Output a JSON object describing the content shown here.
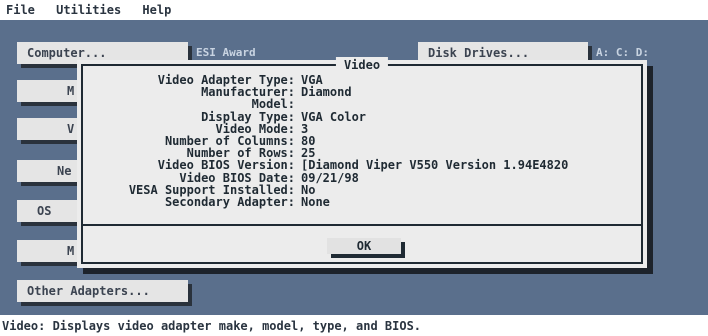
{
  "menu": [
    "File",
    "Utilities",
    "Help"
  ],
  "buttons": {
    "computer": {
      "label": "Computer...",
      "value": "ESI Award"
    },
    "disk_drives": {
      "label": "Disk Drives...",
      "value": "A: C: D:"
    },
    "b2": {
      "label": "M"
    },
    "b3": {
      "label": "V"
    },
    "b4": {
      "label": "Ne"
    },
    "b5": {
      "label": "OS"
    },
    "b6": {
      "label": "M"
    },
    "other_adapters": {
      "label": "Other Adapters..."
    }
  },
  "dialog": {
    "title": "Video",
    "fields": [
      {
        "label": "Video Adapter Type:",
        "value": "VGA"
      },
      {
        "label": "Manufacturer:",
        "value": "Diamond"
      },
      {
        "label": "Model:",
        "value": ""
      },
      {
        "label": "Display Type:",
        "value": "VGA Color"
      },
      {
        "label": "Video Mode:",
        "value": "3"
      },
      {
        "label": "Number of Columns:",
        "value": "80"
      },
      {
        "label": "Number of Rows:",
        "value": "25"
      },
      {
        "label": "Video BIOS Version:",
        "value": "[Diamond Viper V550 Version 1.94E4820"
      },
      {
        "label": "Video BIOS Date:",
        "value": "09/21/98"
      },
      {
        "label": "VESA Support Installed:",
        "value": "No"
      },
      {
        "label": "Secondary Adapter:",
        "value": "None"
      }
    ],
    "ok_label": "OK"
  },
  "status": "Video: Displays video adapter make, model, type, and BIOS."
}
